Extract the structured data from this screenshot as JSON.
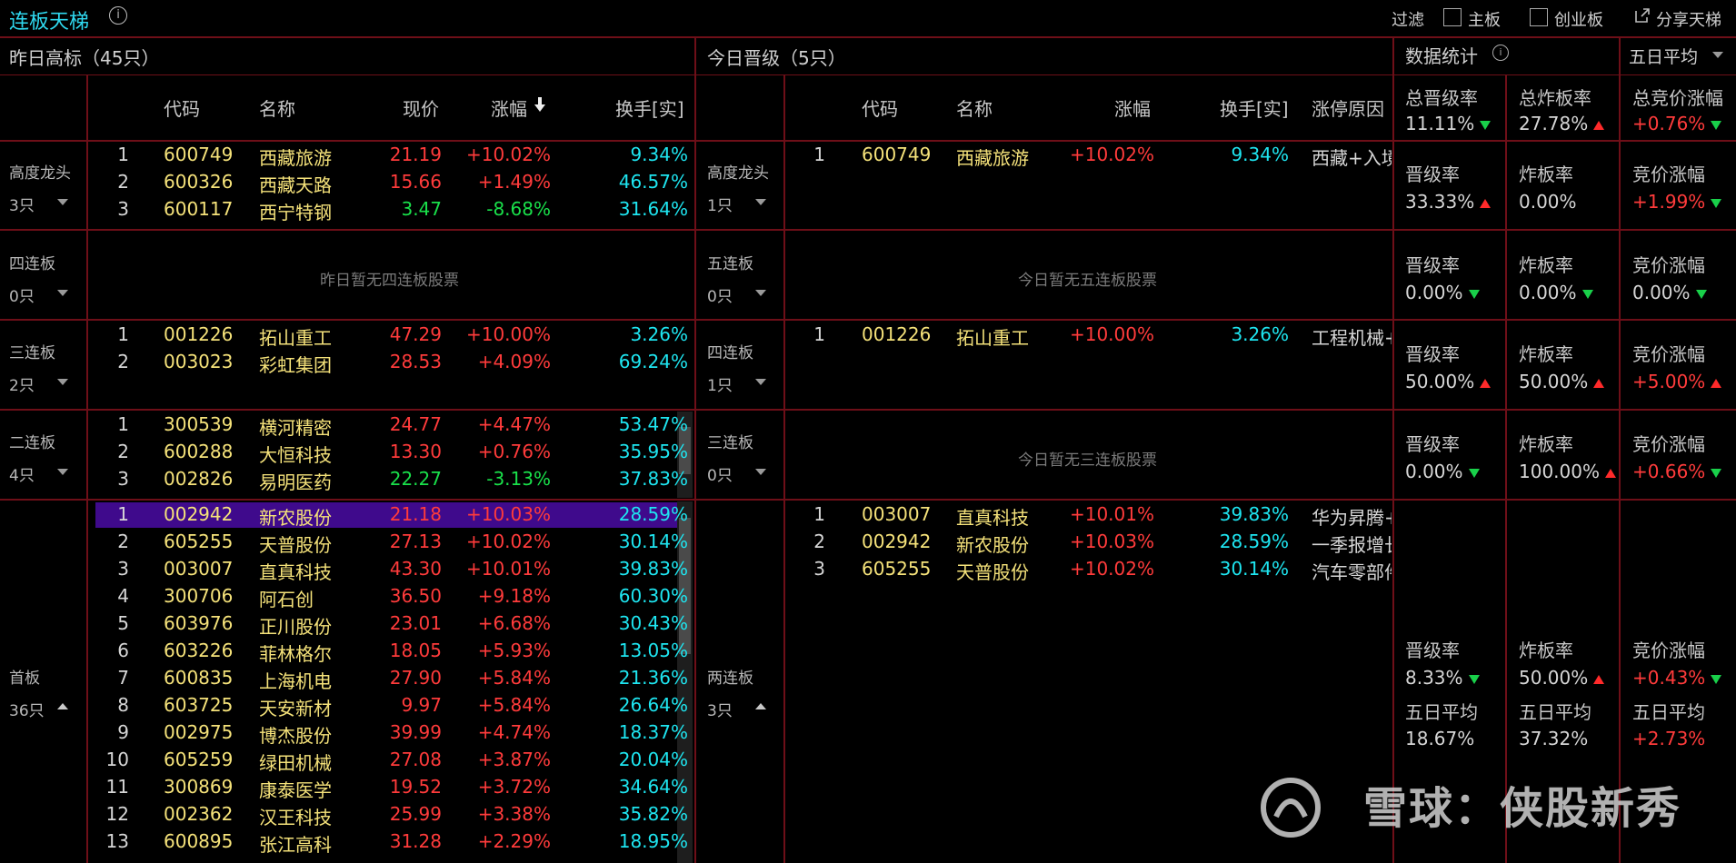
{
  "app": {
    "title": "连板天梯"
  },
  "toolbar": {
    "filter_label": "过滤",
    "main_board_label": "主板",
    "gem_label": "创业板",
    "share_label": "分享天梯"
  },
  "left_panel": {
    "title": "昨日高标（45只）",
    "columns": [
      "代码",
      "名称",
      "现价",
      "涨幅",
      "换手[实]"
    ],
    "sections": [
      {
        "name": "高度龙头",
        "count": "3只",
        "rows": [
          {
            "idx": "1",
            "code": "600749",
            "name": "西藏旅游",
            "price": "21.19",
            "chg": "+10.02%",
            "turn": "9.34%",
            "dir": "up"
          },
          {
            "idx": "2",
            "code": "600326",
            "name": "西藏天路",
            "price": "15.66",
            "chg": "+1.49%",
            "turn": "46.57%",
            "dir": "up"
          },
          {
            "idx": "3",
            "code": "600117",
            "name": "西宁特钢",
            "price": "3.47",
            "chg": "-8.68%",
            "turn": "31.64%",
            "dir": "down"
          }
        ]
      },
      {
        "name": "四连板",
        "count": "0只",
        "empty_text": "昨日暂无四连板股票",
        "rows": []
      },
      {
        "name": "三连板",
        "count": "2只",
        "rows": [
          {
            "idx": "1",
            "code": "001226",
            "name": "拓山重工",
            "price": "47.29",
            "chg": "+10.00%",
            "turn": "3.26%",
            "dir": "up"
          },
          {
            "idx": "2",
            "code": "003023",
            "name": "彩虹集团",
            "price": "28.53",
            "chg": "+4.09%",
            "turn": "69.24%",
            "dir": "up"
          }
        ]
      },
      {
        "name": "二连板",
        "count": "4只",
        "rows": [
          {
            "idx": "1",
            "code": "300539",
            "name": "横河精密",
            "price": "24.77",
            "chg": "+4.47%",
            "turn": "53.47%",
            "dir": "up"
          },
          {
            "idx": "2",
            "code": "600288",
            "name": "大恒科技",
            "price": "13.30",
            "chg": "+0.76%",
            "turn": "35.95%",
            "dir": "up"
          },
          {
            "idx": "3",
            "code": "002826",
            "name": "易明医药",
            "price": "22.27",
            "chg": "-3.13%",
            "turn": "37.83%",
            "dir": "down"
          }
        ]
      },
      {
        "name": "首板",
        "count": "36只",
        "rows": [
          {
            "idx": "1",
            "code": "002942",
            "name": "新农股份",
            "price": "21.18",
            "chg": "+10.03%",
            "turn": "28.59%",
            "dir": "up"
          },
          {
            "idx": "2",
            "code": "605255",
            "name": "天普股份",
            "price": "27.13",
            "chg": "+10.02%",
            "turn": "30.14%",
            "dir": "up"
          },
          {
            "idx": "3",
            "code": "003007",
            "name": "直真科技",
            "price": "43.30",
            "chg": "+10.01%",
            "turn": "39.83%",
            "dir": "up"
          },
          {
            "idx": "4",
            "code": "300706",
            "name": "阿石创",
            "price": "36.50",
            "chg": "+9.18%",
            "turn": "60.30%",
            "dir": "up"
          },
          {
            "idx": "5",
            "code": "603976",
            "name": "正川股份",
            "price": "23.01",
            "chg": "+6.68%",
            "turn": "30.43%",
            "dir": "up"
          },
          {
            "idx": "6",
            "code": "603226",
            "name": "菲林格尔",
            "price": "18.05",
            "chg": "+5.93%",
            "turn": "13.05%",
            "dir": "up"
          },
          {
            "idx": "7",
            "code": "600835",
            "name": "上海机电",
            "price": "27.90",
            "chg": "+5.84%",
            "turn": "21.36%",
            "dir": "up"
          },
          {
            "idx": "8",
            "code": "603725",
            "name": "天安新材",
            "price": "9.97",
            "chg": "+5.84%",
            "turn": "26.64%",
            "dir": "up"
          },
          {
            "idx": "9",
            "code": "002975",
            "name": "博杰股份",
            "price": "39.99",
            "chg": "+4.74%",
            "turn": "18.37%",
            "dir": "up"
          },
          {
            "idx": "10",
            "code": "605259",
            "name": "绿田机械",
            "price": "27.08",
            "chg": "+3.87%",
            "turn": "20.04%",
            "dir": "up"
          },
          {
            "idx": "11",
            "code": "300869",
            "name": "康泰医学",
            "price": "19.52",
            "chg": "+3.72%",
            "turn": "34.64%",
            "dir": "up"
          },
          {
            "idx": "12",
            "code": "002362",
            "name": "汉王科技",
            "price": "25.99",
            "chg": "+3.38%",
            "turn": "35.82%",
            "dir": "up"
          },
          {
            "idx": "13",
            "code": "600895",
            "name": "张江高科",
            "price": "31.28",
            "chg": "+2.29%",
            "turn": "18.95%",
            "dir": "up"
          }
        ]
      }
    ]
  },
  "right_panel": {
    "title": "今日晋级（5只）",
    "columns": [
      "代码",
      "名称",
      "涨幅",
      "换手[实]",
      "涨停原因"
    ],
    "sections": [
      {
        "name": "高度龙头",
        "count": "1只",
        "rows": [
          {
            "idx": "1",
            "code": "600749",
            "name": "西藏旅游",
            "chg": "+10.02%",
            "turn": "9.34%",
            "reason": "西藏+入境"
          }
        ]
      },
      {
        "name": "五连板",
        "count": "0只",
        "empty_text": "今日暂无五连板股票",
        "rows": []
      },
      {
        "name": "四连板",
        "count": "1只",
        "rows": [
          {
            "idx": "1",
            "code": "001226",
            "name": "拓山重工",
            "chg": "+10.00%",
            "turn": "3.26%",
            "reason": "工程机械+"
          }
        ]
      },
      {
        "name": "三连板",
        "count": "0只",
        "empty_text": "今日暂无三连板股票",
        "rows": []
      },
      {
        "name": "两连板",
        "count": "3只",
        "rows": [
          {
            "idx": "1",
            "code": "003007",
            "name": "直真科技",
            "chg": "+10.01%",
            "turn": "39.83%",
            "reason": "华为昇腾+"
          },
          {
            "idx": "2",
            "code": "002942",
            "name": "新农股份",
            "chg": "+10.03%",
            "turn": "28.59%",
            "reason": "一季报增长"
          },
          {
            "idx": "3",
            "code": "605255",
            "name": "天普股份",
            "chg": "+10.02%",
            "turn": "30.14%",
            "reason": "汽车零部件"
          }
        ]
      }
    ]
  },
  "stats": {
    "title": "数据统计",
    "period_select": "五日平均",
    "totals": [
      {
        "label": "总晋级率",
        "value": "11.11%",
        "dir": "down"
      },
      {
        "label": "总炸板率",
        "value": "27.78%",
        "dir": "up"
      },
      {
        "label": "总竞价涨幅",
        "value": "+0.76%",
        "dir": "down"
      }
    ],
    "rows": [
      [
        {
          "label": "晋级率",
          "value": "33.33%",
          "dir": "up"
        },
        {
          "label": "炸板率",
          "value": "0.00%",
          "dir": ""
        },
        {
          "label": "竞价涨幅",
          "value": "+1.99%",
          "dir": "down"
        }
      ],
      [
        {
          "label": "晋级率",
          "value": "0.00%",
          "dir": "down"
        },
        {
          "label": "炸板率",
          "value": "0.00%",
          "dir": "down"
        },
        {
          "label": "竞价涨幅",
          "value": "0.00%",
          "dir": "down"
        }
      ],
      [
        {
          "label": "晋级率",
          "value": "50.00%",
          "dir": "up"
        },
        {
          "label": "炸板率",
          "value": "50.00%",
          "dir": "up"
        },
        {
          "label": "竞价涨幅",
          "value": "+5.00%",
          "dir": "up"
        }
      ],
      [
        {
          "label": "晋级率",
          "value": "0.00%",
          "dir": "down"
        },
        {
          "label": "炸板率",
          "value": "100.00%",
          "dir": "up"
        },
        {
          "label": "竞价涨幅",
          "value": "+0.66%",
          "dir": "down"
        }
      ],
      [
        {
          "label": "晋级率",
          "value": "8.33%",
          "dir": "down",
          "avg_label": "五日平均",
          "avg": "18.67%"
        },
        {
          "label": "炸板率",
          "value": "50.00%",
          "dir": "up",
          "avg_label": "五日平均",
          "avg": "37.32%"
        },
        {
          "label": "竞价涨幅",
          "value": "+0.43%",
          "dir": "down",
          "avg_label": "五日平均",
          "avg": "+2.73%"
        }
      ]
    ]
  },
  "watermark": "雪球：侠股新秀"
}
